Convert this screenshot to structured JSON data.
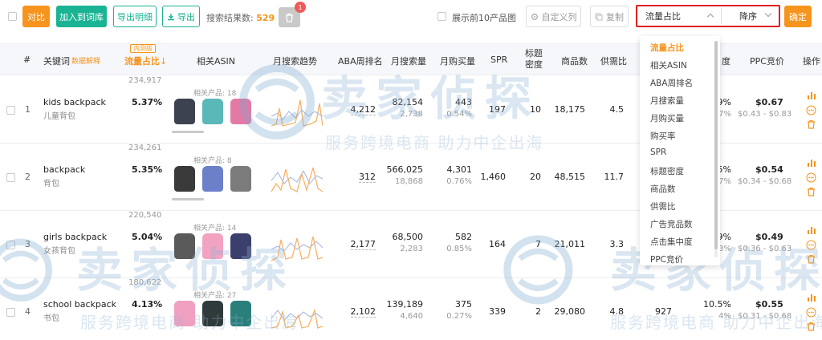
{
  "toolbar": {
    "compare_label": "对比",
    "add_to_lexicon_label": "加入到词库",
    "export_detail_label": "导出明细",
    "export_label": "导出",
    "result_count_label": "搜索结果数:",
    "result_count_value": "529",
    "trash_badge": "1",
    "show_top10_label": "展示前10产品图",
    "custom_columns_label": "自定义列",
    "copy_label": "复制",
    "sort_field_value": "流量占比",
    "sort_order_value": "降序",
    "confirm_label": "确定"
  },
  "table": {
    "headers": {
      "index": "#",
      "keyword": "关键词",
      "data_explain": "数据解释",
      "inner_test_tag": "内测版",
      "traffic_share": "流量占比",
      "sort_arrow": "↓",
      "related_asin": "相关ASIN",
      "monthly_search_trend": "月搜索趋势",
      "aba_rank": "ABA周排名",
      "monthly_search_volume": "月搜索量",
      "monthly_purchase": "月购买量",
      "spr": "SPR",
      "title_density": "标题\n密度",
      "product_count": "商品数",
      "supply_demand": "供需比",
      "click_conc": "度",
      "ppc_bid": "PPC竞价",
      "operation": "操作"
    },
    "rows": [
      {
        "index": "1",
        "keyword": "kids backpack",
        "keyword_cn": "儿童背包",
        "traffic_pct": "5.37%",
        "traffic_num": "234,917",
        "related_label": "相关产品: 18",
        "aba_rank": "4,212",
        "search_volume": "82,154",
        "search_sub": "2,738",
        "purchase": "443",
        "purchase_rate": "0.54%",
        "spr": "197",
        "title_density": "10",
        "product_count": "18,175",
        "supply_demand": "4.5",
        "conc": "9%",
        "conc_sub": "7%",
        "ppc": "$0.67",
        "ppc_range": "$0.43 - $0.83"
      },
      {
        "index": "2",
        "keyword": "backpack",
        "keyword_cn": "背包",
        "traffic_pct": "5.35%",
        "traffic_num": "234,261",
        "related_label": "相关产品: 8",
        "aba_rank": "312",
        "search_volume": "566,025",
        "search_sub": "18,868",
        "purchase": "4,301",
        "purchase_rate": "0.76%",
        "spr": "1,460",
        "title_density": "20",
        "product_count": "48,515",
        "supply_demand": "11.7",
        "conc": "5%",
        "conc_sub": "7%",
        "ppc": "$0.54",
        "ppc_range": "$0.34 - $0.68"
      },
      {
        "index": "3",
        "keyword": "girls backpack",
        "keyword_cn": "女孩背包",
        "traffic_pct": "5.04%",
        "traffic_num": "220,540",
        "related_label": "相关产品: 14",
        "aba_rank": "2,177",
        "search_volume": "68,500",
        "search_sub": "2,283",
        "purchase": "582",
        "purchase_rate": "0.85%",
        "spr": "164",
        "title_density": "7",
        "product_count": "21,011",
        "supply_demand": "3.3",
        "conc": "9%",
        "conc_sub": "3%",
        "ppc": "$0.49",
        "ppc_range": "$0.36 - $0.63"
      },
      {
        "index": "4",
        "keyword": "school backpack",
        "keyword_cn": "书包",
        "traffic_pct": "4.13%",
        "traffic_num": "180,622",
        "related_label": "相关产品: 27",
        "aba_rank": "2,102",
        "search_volume": "139,189",
        "search_sub": "4,640",
        "purchase": "375",
        "purchase_rate": "0.27%",
        "spr": "339",
        "title_density": "2",
        "product_count": "29,080",
        "supply_demand": "4.8",
        "click_extra": "927",
        "conc": "10.5%",
        "conc_sub": "4%",
        "ppc": "$0.55",
        "ppc_range": "$0.31 - $0.68"
      }
    ]
  },
  "sort_dropdown": {
    "items": [
      "流量占比",
      "相关ASIN",
      "ABA周排名",
      "月搜索量",
      "月购买量",
      "购买率",
      "SPR",
      "标题密度",
      "商品数",
      "供需比",
      "广告竞品数",
      "点击集中度",
      "PPC竞价"
    ]
  },
  "watermark": {
    "brand": "卖家侦探",
    "slogan": "服务跨境电商 助力中企出海"
  },
  "colors": {
    "accent_orange": "#f7941d",
    "teal": "#1ab394",
    "highlight_red": "#e02020"
  },
  "icons": {
    "export": "download-icon",
    "trash": "trash-icon",
    "custom_columns": "gear-icon",
    "copy": "copy-icon",
    "row_chart": "bar-chart-icon",
    "row_more": "more-icon",
    "row_delete": "trash-icon"
  }
}
